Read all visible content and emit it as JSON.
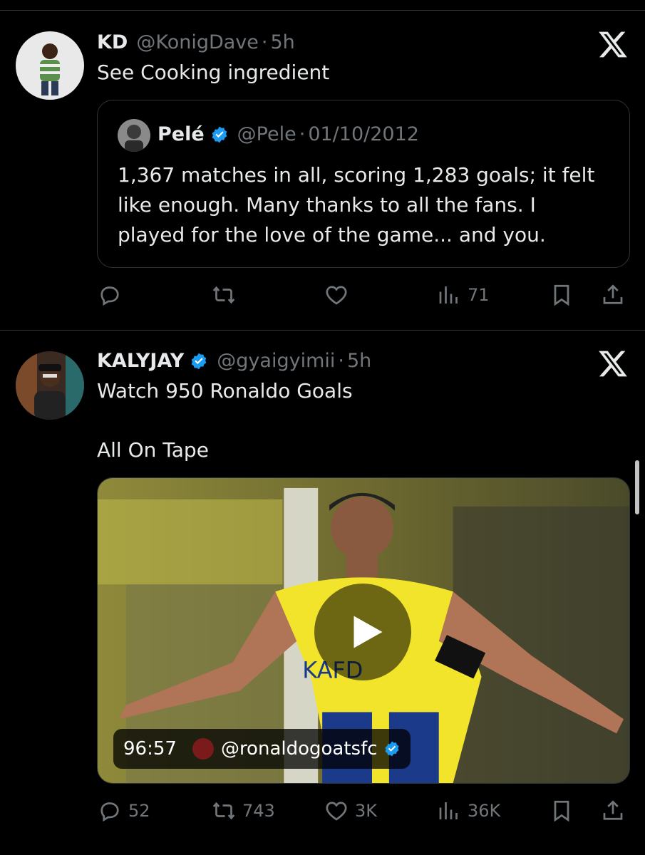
{
  "tweet1": {
    "name": "KD",
    "handle": "@KonigDave",
    "separator": "·",
    "time": "5h",
    "text": "See Cooking ingredient",
    "quote": {
      "name": "Pelé",
      "handle": "@Pele",
      "separator": "·",
      "date": "01/10/2012",
      "lines": [
        "1,367 matches in all, scoring 1,283 goals; it felt",
        "like enough. Many thanks to all the fans. I",
        "played for the love of the game... and you."
      ]
    },
    "actions": {
      "views": "71"
    }
  },
  "tweet2": {
    "name": "KALYJAY",
    "handle": "@gyaigyimii",
    "separator": "·",
    "time": "5h",
    "text_line1": "Watch 950 Ronaldo Goals",
    "text_line2": "All On Tape",
    "media": {
      "duration": "96:57",
      "source_handle": "@ronaldogoatsfc",
      "jersey_text": "KAFD"
    },
    "actions": {
      "replies": "52",
      "reposts": "743",
      "likes": "3K",
      "views": "36K"
    }
  },
  "colors": {
    "background": "#000000",
    "muted": "#71767b",
    "verified": "#1d9bf0",
    "divider": "#2f3336"
  },
  "icons": [
    "x-logo-icon",
    "verified-badge-icon",
    "reply-icon",
    "repost-icon",
    "like-icon",
    "views-icon",
    "bookmark-icon",
    "share-icon",
    "play-icon"
  ]
}
